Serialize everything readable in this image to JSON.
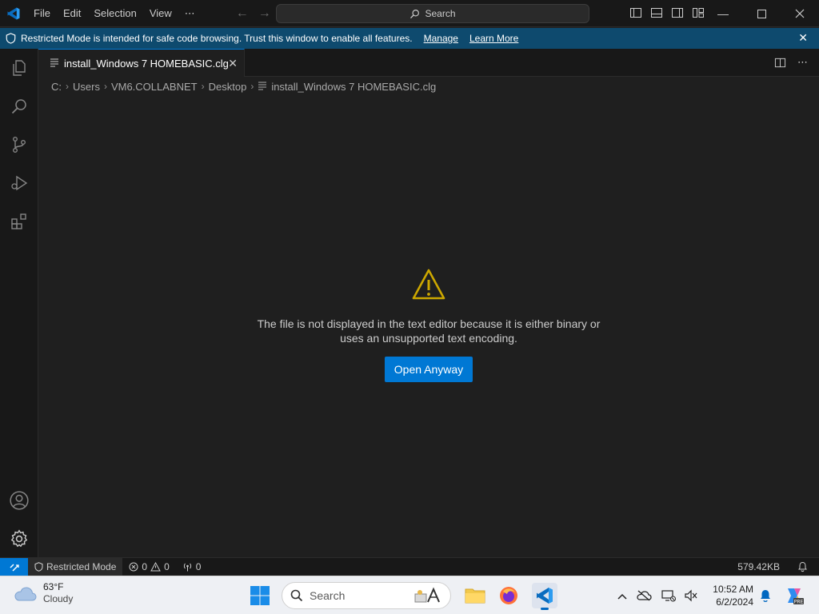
{
  "titlebar": {
    "menu": [
      "File",
      "Edit",
      "Selection",
      "View",
      "⋯"
    ],
    "search_label": "Search"
  },
  "banner": {
    "message": "Restricted Mode is intended for safe code browsing. Trust this window to enable all features.",
    "manage": "Manage",
    "learn_more": "Learn More"
  },
  "tab": {
    "label": "install_Windows 7 HOMEBASIC.clg"
  },
  "breadcrumb": [
    "C:",
    "Users",
    "VM6.COLLABNET",
    "Desktop",
    "install_Windows 7 HOMEBASIC.clg"
  ],
  "editor": {
    "message_line1": "The file is not displayed in the text editor because it is either binary or",
    "message_line2": "uses an unsupported text encoding.",
    "open_button": "Open Anyway"
  },
  "statusbar": {
    "restricted": "Restricted Mode",
    "errors": "0",
    "warnings": "0",
    "ports": "0",
    "file_size": "579.42KB"
  },
  "taskbar": {
    "temperature": "63°F",
    "condition": "Cloudy",
    "search_placeholder": "Search",
    "time": "10:52 AM",
    "date": "6/2/2024"
  },
  "colors": {
    "accent": "#0078d4",
    "banner": "#0e4a6e",
    "warning": "#cca700"
  }
}
